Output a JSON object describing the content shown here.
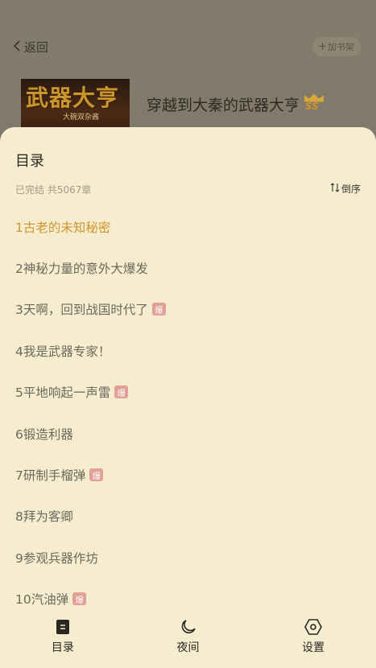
{
  "header": {
    "back_label": "返回",
    "shelf_label": "加书架",
    "book_title": "穿越到大秦的武器大亨",
    "badge": "SS",
    "cover_title": "武器大亨",
    "cover_author": "大碗双杂酱"
  },
  "toc": {
    "title": "目录",
    "meta": "已完结 共5067章",
    "sort_label": "倒序",
    "chapters": [
      {
        "label": "1古老的未知秘密",
        "current": true,
        "hot": false
      },
      {
        "label": "2神秘力量的意外大爆发",
        "current": false,
        "hot": false
      },
      {
        "label": "3天啊，回到战国时代了",
        "current": false,
        "hot": true
      },
      {
        "label": "4我是武器专家！",
        "current": false,
        "hot": false
      },
      {
        "label": "5平地响起一声雷",
        "current": false,
        "hot": true
      },
      {
        "label": "6锻造利器",
        "current": false,
        "hot": false
      },
      {
        "label": "7研制手榴弹",
        "current": false,
        "hot": true
      },
      {
        "label": "8拜为客卿",
        "current": false,
        "hot": false
      },
      {
        "label": "9参观兵器作坊",
        "current": false,
        "hot": false
      },
      {
        "label": "10汽油弹",
        "current": false,
        "hot": true
      }
    ],
    "hot_badge": "爆"
  },
  "nav": {
    "toc_label": "目录",
    "night_label": "夜间",
    "settings_label": "设置"
  },
  "colors": {
    "sheet_bg": "#f6ecd0",
    "current_chapter": "#d0962d",
    "chapter_text": "#6f695b",
    "hot_badge": "#e2a198"
  },
  "icons": {
    "back": "chevron-left-icon",
    "shelf": "plus-icon",
    "sort": "sort-arrows-icon",
    "toc": "book-icon",
    "night": "moon-icon",
    "settings": "hexagon-gear-icon"
  }
}
